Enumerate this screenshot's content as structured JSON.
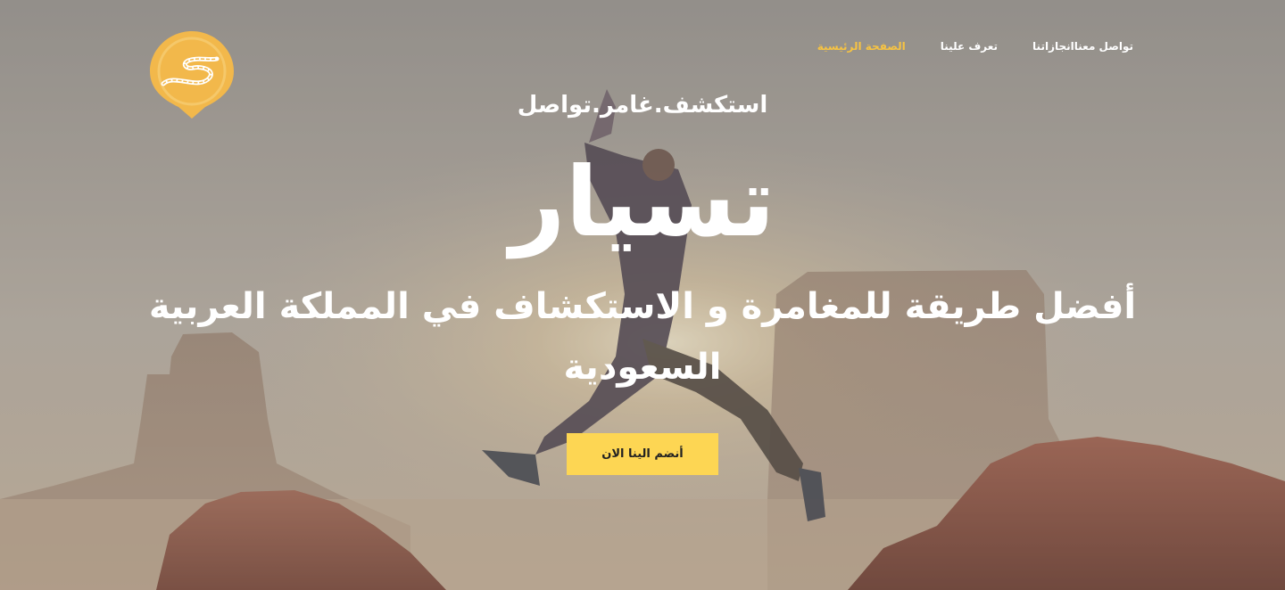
{
  "brand_logo": {
    "icon": "winding-road-pin-icon",
    "color": "#f2b84b"
  },
  "nav": {
    "items": [
      {
        "label": "الصفحة الرئيسية",
        "active": true
      },
      {
        "label": "تعرف علينا",
        "active": false
      },
      {
        "label": "انجازاتنا",
        "active": false
      },
      {
        "label": "تواصل معنا",
        "active": false
      }
    ]
  },
  "hero": {
    "tagline": "استكشف.غامر.تواصل",
    "brand_name": "تسيار",
    "headline": "أفضل طريقة للمغامرة و الاستكشاف في المملكة العربية السعودية",
    "cta_label": "أنضم الينا الان"
  },
  "colors": {
    "accent": "#f6c343",
    "cta_background": "#fdd653",
    "text": "#ffffff"
  }
}
